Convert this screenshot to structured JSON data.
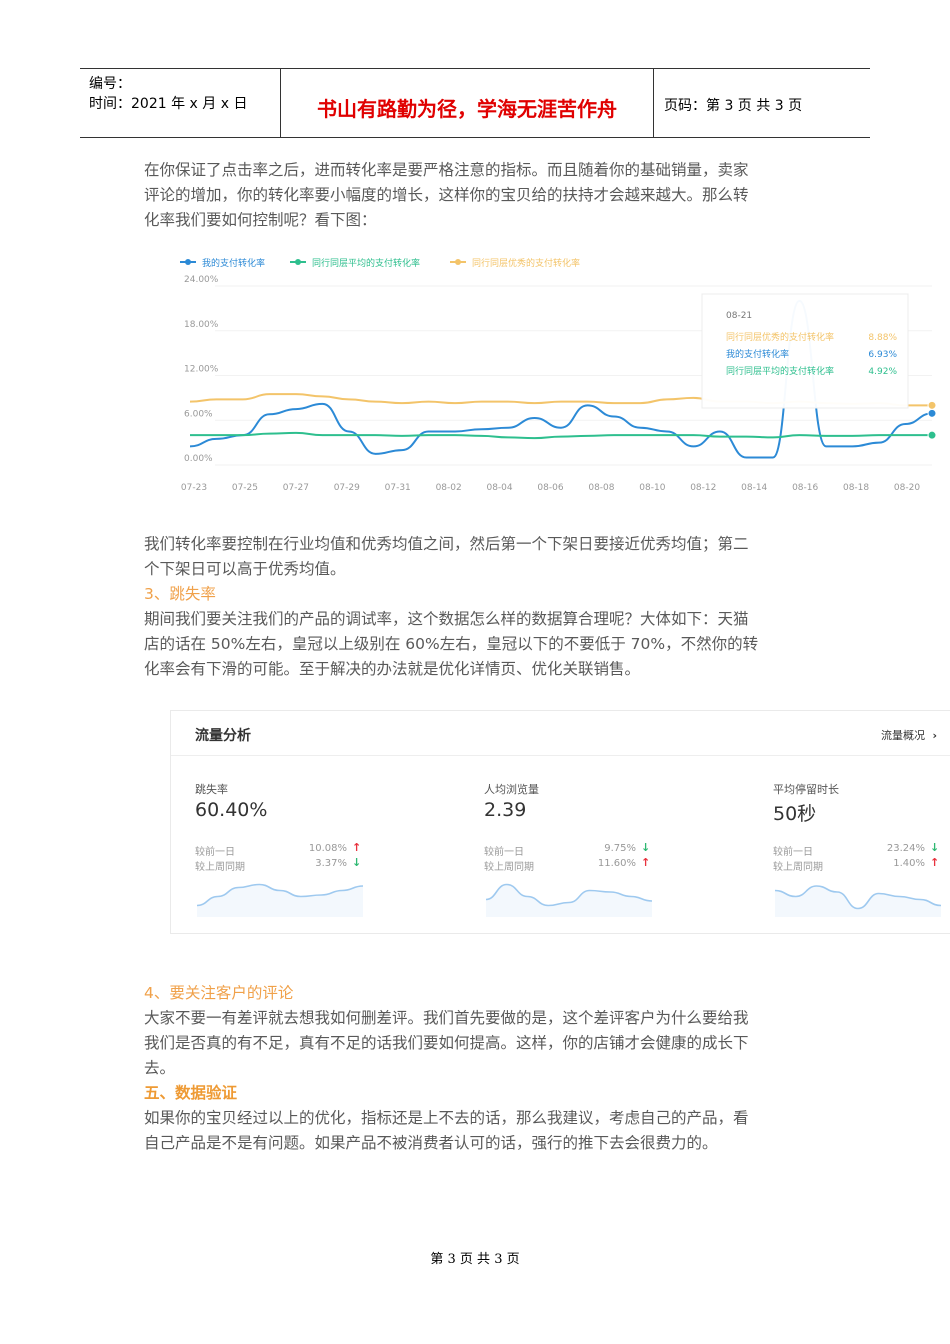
{
  "header": {
    "code_label": "编号：",
    "date_label": "时间：2021 年 x 月 x 日",
    "motto": "书山有路勤为径，学海无涯苦作舟",
    "page_label": "页码：第 3 页  共 3 页"
  },
  "paragraphs": {
    "p1_l1": "在你保证了点击率之后，进而转化率是要严格注意的指标。而且随着你的基础销量，卖家",
    "p1_l2": "评论的增加，你的转化率要小幅度的增长，这样你的宝贝给的扶持才会越来越大。那么转",
    "p1_l3": "化率我们要如何控制呢？看下图：",
    "p2_l1": "我们转化率要控制在行业均值和优秀均值之间，然后第一个下架日要接近优秀均值；第二",
    "p2_l2": "个下架日可以高于优秀均值。",
    "h3": "3、跳失率",
    "p3_l1": "期间我们要关注我们的产品的调试率，这个数据怎么样的数据算合理呢？大体如下：天猫",
    "p3_l2": "店的话在 50%左右，皇冠以上级别在 60%左右，皇冠以下的不要低于 70%，不然你的转",
    "p3_l3": "化率会有下滑的可能。至于解决的办法就是优化详情页、优化关联销售。",
    "h4": "4、要关注客户的评论",
    "p4_l1": "大家不要一有差评就去想我如何删差评。我们首先要做的是，这个差评客户为什么要给我",
    "p4_l2": "我们是否真的有不足，真有不足的话我们要如何提高。这样，你的店铺才会健康的成长下",
    "p4_l3": "去。",
    "h5": "五、数据验证",
    "p5_l1": "如果你的宝贝经过以上的优化，指标还是上不去的话，那么我建议，考虑自己的产品，看",
    "p5_l2": "自己产品是不是有问题。如果产品不被消费者认可的话，强行的推下去会很费力的。"
  },
  "chart_data": {
    "type": "line",
    "legend": [
      "我的支付转化率",
      "同行同层平均的支付转化率",
      "同行同层优秀的支付转化率"
    ],
    "colors": [
      "#2c8ad6",
      "#2ebf8e",
      "#f3c46a"
    ],
    "y_ticks": [
      "24.00%",
      "18.00%",
      "12.00%",
      "6.00%",
      "0.00%"
    ],
    "ylim": [
      0,
      24
    ],
    "x_ticks": [
      "07-23",
      "07-25",
      "07-27",
      "07-29",
      "07-31",
      "08-02",
      "08-04",
      "08-06",
      "08-08",
      "08-10",
      "08-12",
      "08-14",
      "08-16",
      "08-18",
      "08-20"
    ],
    "series": [
      {
        "name": "我的支付转化率",
        "values": [
          2.5,
          3.5,
          4.0,
          6.8,
          7.5,
          8.2,
          4.5,
          1.5,
          2.0,
          4.5,
          4.5,
          4.8,
          5.0,
          6.3,
          5.0,
          8.0,
          6.5,
          5.0,
          4.5,
          2.5,
          4.5,
          1.0,
          1.0,
          22.0,
          2.5,
          2.5,
          3.0,
          5.5,
          6.93
        ]
      },
      {
        "name": "同行同层平均的支付转化率",
        "values": [
          4.0,
          4.0,
          4.0,
          4.2,
          4.3,
          4.0,
          4.0,
          4.0,
          3.9,
          4.0,
          4.0,
          3.9,
          3.7,
          3.6,
          3.8,
          3.9,
          4.0,
          4.0,
          4.0,
          4.0,
          3.8,
          3.8,
          3.7,
          4.0,
          3.9,
          3.9,
          4.0,
          4.0,
          4.0
        ]
      },
      {
        "name": "同行同层优秀的支付转化率",
        "values": [
          8.5,
          8.8,
          8.8,
          9.5,
          9.5,
          9.2,
          8.8,
          8.5,
          8.3,
          8.5,
          8.3,
          8.5,
          8.5,
          8.3,
          8.5,
          8.5,
          8.3,
          8.3,
          8.8,
          9.0,
          8.5,
          8.5,
          8.3,
          8.5,
          8.3,
          8.2,
          8.3,
          8.0,
          8.0
        ]
      }
    ],
    "tooltip": {
      "date": "08-21",
      "rows": [
        {
          "label": "同行同层优秀的支付转化率",
          "value": "8.88%"
        },
        {
          "label": "我的支付转化率",
          "value": "6.93%"
        },
        {
          "label": "同行同层平均的支付转化率",
          "value": "4.92%"
        }
      ]
    }
  },
  "traffic": {
    "title": "流量分析",
    "more_label": "流量概况",
    "more_icon": "chevron-right-icon",
    "up_color": "#e8323e",
    "down_color": "#2eb872",
    "line_color": "#9ec9ef",
    "metrics": [
      {
        "name": "跳失率",
        "value": "60.40%",
        "r1_label": "较前一日",
        "r1_value": "10.08%",
        "r1_dir": "up",
        "r2_label": "较上周同期",
        "r2_value": "3.37%",
        "r2_dir": "down",
        "spark": [
          0.25,
          0.55,
          0.85,
          0.95,
          0.75,
          0.55,
          0.6,
          0.75,
          0.9
        ]
      },
      {
        "name": "人均浏览量",
        "value": "2.39",
        "r1_label": "较前一日",
        "r1_value": "9.75%",
        "r1_dir": "down",
        "r2_label": "较上周同期",
        "r2_value": "11.60%",
        "r2_dir": "up",
        "spark": [
          0.45,
          0.95,
          0.55,
          0.25,
          0.35,
          0.75,
          0.7,
          0.55,
          0.4
        ]
      },
      {
        "name": "平均停留时长",
        "value": "50秒",
        "r1_label": "较前一日",
        "r1_value": "23.24%",
        "r1_dir": "down",
        "r2_label": "较上周同期",
        "r2_value": "1.40%",
        "r2_dir": "up",
        "spark": [
          0.75,
          0.55,
          0.9,
          0.7,
          0.15,
          0.65,
          0.55,
          0.45,
          0.25
        ]
      }
    ]
  },
  "footer": "第 3 页  共 3 页"
}
